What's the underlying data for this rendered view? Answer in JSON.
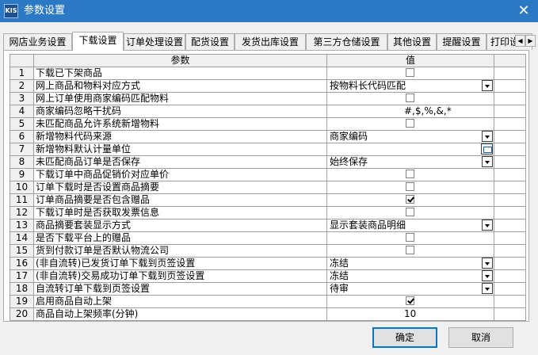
{
  "window": {
    "icon_text": "KIS",
    "title": "参数设置"
  },
  "tabs": [
    {
      "label": "网店业务设置"
    },
    {
      "label": "下载设置"
    },
    {
      "label": "订单处理设置"
    },
    {
      "label": "配货设置"
    },
    {
      "label": "发货出库设置"
    },
    {
      "label": "第三方仓储设置"
    },
    {
      "label": "其他设置"
    },
    {
      "label": "提醒设置"
    },
    {
      "label": "打印设置"
    }
  ],
  "active_tab": 1,
  "grid": {
    "headers": {
      "param": "参数",
      "value": "值"
    },
    "rows": [
      {
        "no": "1",
        "param": "下载已下架商品",
        "type": "checkbox",
        "checked": false
      },
      {
        "no": "2",
        "param": "网上商品和物料对应方式",
        "type": "combo",
        "value": "按物料长代码匹配"
      },
      {
        "no": "3",
        "param": "网上订单使用商家编码匹配物料",
        "type": "checkbox",
        "checked": false
      },
      {
        "no": "4",
        "param": "商家编码忽略干扰码",
        "type": "text",
        "value": "#,$,%,&,*"
      },
      {
        "no": "5",
        "param": "未匹配商品允许系统新增物料",
        "type": "checkbox",
        "checked": false
      },
      {
        "no": "6",
        "param": "新增物料代码来源",
        "type": "combo",
        "value": "商家编码"
      },
      {
        "no": "7",
        "param": "新增物料默认计量单位",
        "type": "picker",
        "value": ""
      },
      {
        "no": "8",
        "param": "未匹配商品订单是否保存",
        "type": "combo",
        "value": "始终保存"
      },
      {
        "no": "9",
        "param": "下载订单中商品促销价对应单价",
        "type": "checkbox",
        "checked": false
      },
      {
        "no": "10",
        "param": "订单下载时是否设置商品摘要",
        "type": "checkbox",
        "checked": false
      },
      {
        "no": "11",
        "param": "订单商品摘要是否包含赠品",
        "type": "checkbox",
        "checked": true
      },
      {
        "no": "12",
        "param": "下载订单时是否获取发票信息",
        "type": "checkbox",
        "checked": false
      },
      {
        "no": "13",
        "param": "商品摘要套装显示方式",
        "type": "combo",
        "value": "显示套装商品明细"
      },
      {
        "no": "14",
        "param": "是否下载平台上的赠品",
        "type": "checkbox",
        "checked": false
      },
      {
        "no": "15",
        "param": "货到付款订单是否默认物流公司",
        "type": "checkbox",
        "checked": false
      },
      {
        "no": "16",
        "param": "(非自流转)已发货订单下载到页签设置",
        "type": "combo",
        "value": "冻结"
      },
      {
        "no": "17",
        "param": "(非自流转)交易成功订单下载到页签设置",
        "type": "combo",
        "value": "冻结"
      },
      {
        "no": "18",
        "param": "自流转订单下载到页签设置",
        "type": "combo",
        "value": "待审"
      },
      {
        "no": "19",
        "param": "启用商品自动上架",
        "type": "checkbox",
        "checked": true
      },
      {
        "no": "20",
        "param": "商品自动上架频率(分钟)",
        "type": "text",
        "value": "10"
      }
    ]
  },
  "buttons": {
    "ok": "确定",
    "cancel": "取消"
  }
}
